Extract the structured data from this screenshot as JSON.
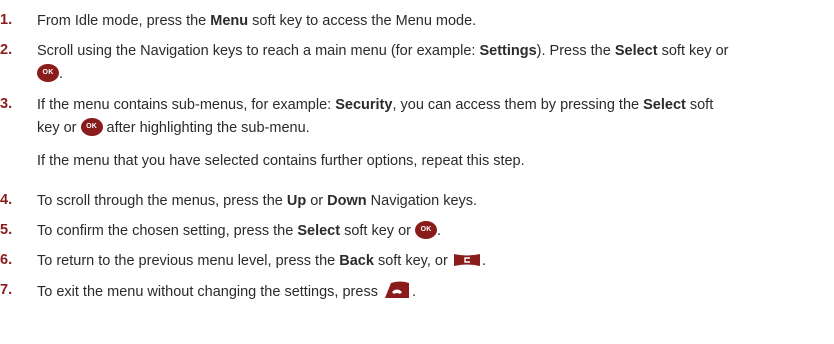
{
  "steps": [
    {
      "number": "1.",
      "lines": [
        [
          "From Idle mode, press the ",
          {
            "b": "Menu"
          },
          " soft key to access the Menu mode."
        ]
      ]
    },
    {
      "number": "2.",
      "lines": [
        [
          "Scroll using the Navigation keys to reach a main menu (for example: ",
          {
            "b": "Settings"
          },
          "). Press the ",
          {
            "b": "Select"
          },
          " soft key or"
        ],
        [
          {
            "icon": "ok"
          },
          "."
        ]
      ]
    },
    {
      "number": "3.",
      "lines": [
        [
          "If the menu contains sub-menus, for example: ",
          {
            "b": "Security"
          },
          ", you can access them by pressing the ",
          {
            "b": "Select"
          },
          " soft"
        ],
        [
          "key or ",
          {
            "icon": "ok"
          },
          " after highlighting the sub-menu."
        ],
        [
          "If the menu that you have selected contains further options, repeat this step."
        ]
      ]
    },
    {
      "number": "4.",
      "lines": [
        [
          "To scroll through the menus, press the ",
          {
            "b": "Up"
          },
          " or ",
          {
            "b": "Down"
          },
          " Navigation keys."
        ]
      ]
    },
    {
      "number": "5.",
      "lines": [
        [
          "To confirm the chosen setting, press the ",
          {
            "b": "Select"
          },
          " soft key or ",
          {
            "icon": "ok"
          },
          "."
        ]
      ]
    },
    {
      "number": "6.",
      "lines": [
        [
          "To return to the previous menu level, press the ",
          {
            "b": "Back"
          },
          " soft key, or ",
          {
            "icon": "back"
          },
          "."
        ]
      ]
    },
    {
      "number": "7.",
      "lines": [
        [
          "To exit the menu without changing the settings, press ",
          {
            "icon": "end"
          },
          "."
        ]
      ]
    }
  ],
  "icons": {
    "ok": {
      "name": "ok-key-icon",
      "label": "OK",
      "color": "#8a1c1c"
    },
    "back": {
      "name": "back-key-icon",
      "color": "#8a1c1c"
    },
    "end": {
      "name": "end-key-icon",
      "color": "#8a1c1c"
    }
  },
  "colors": {
    "number": "#8a1c1c",
    "text": "#2b2b2b"
  }
}
